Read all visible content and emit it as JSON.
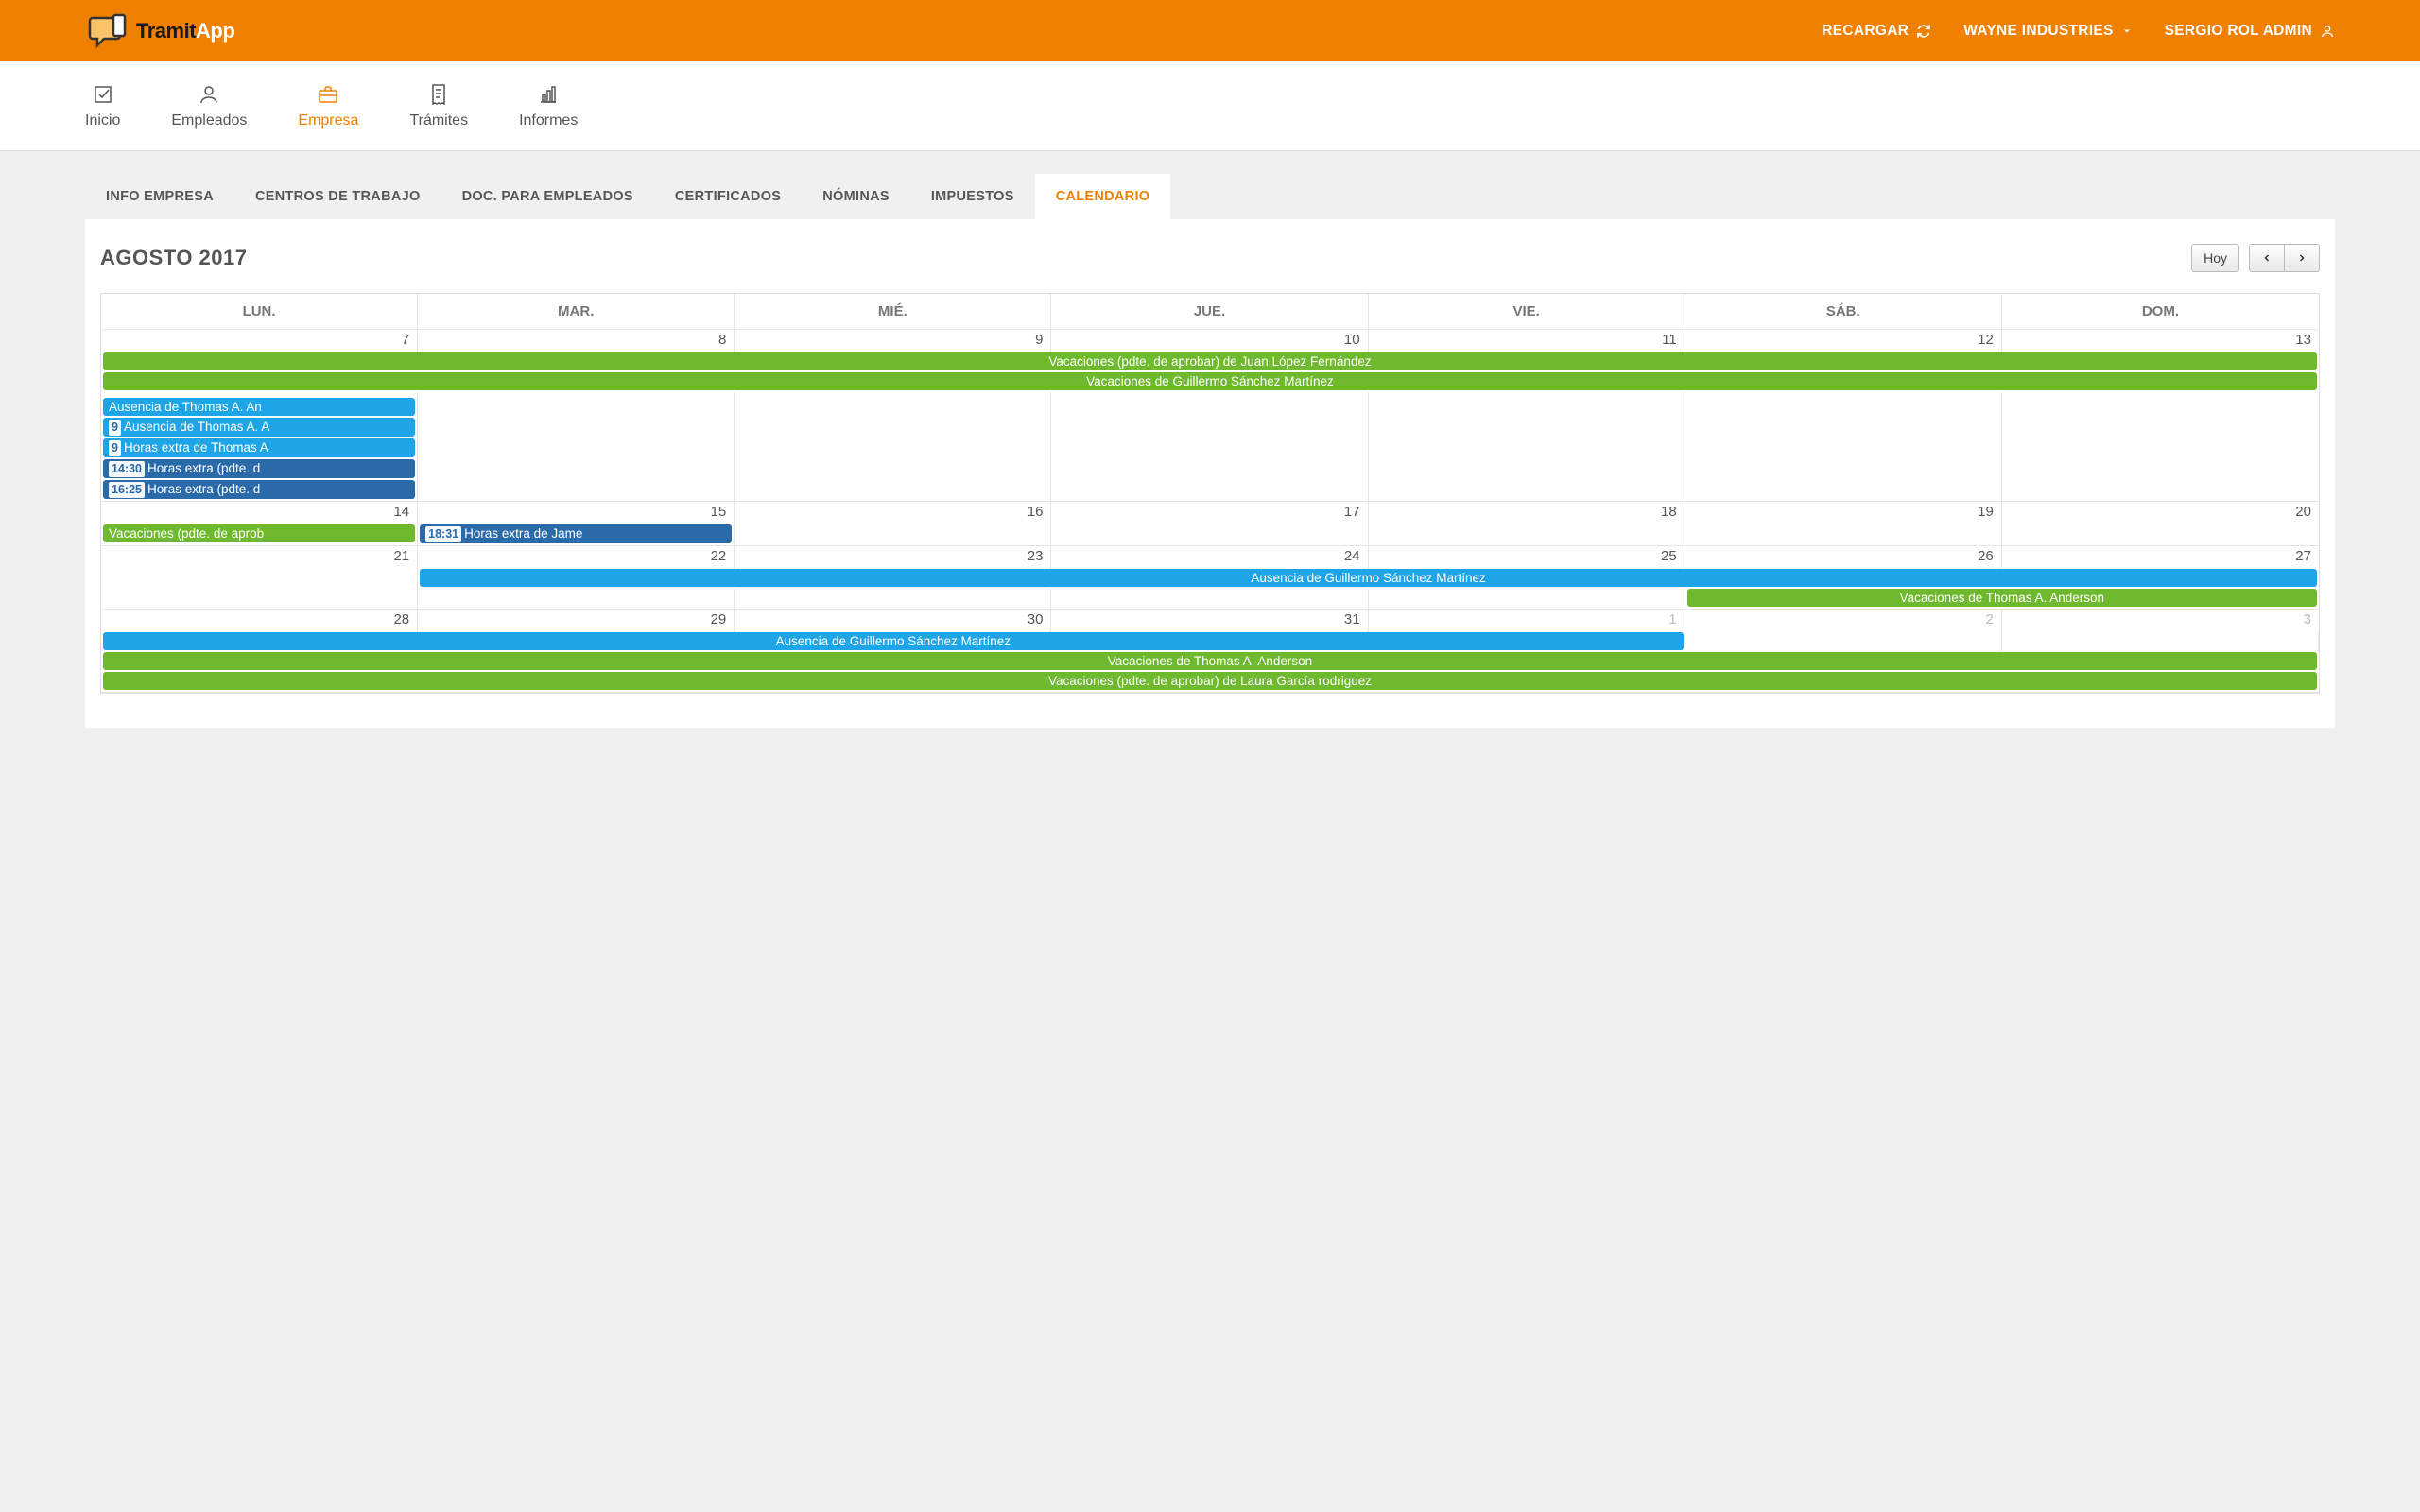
{
  "logo": {
    "brand": "Tramit",
    "suffix": "App"
  },
  "top": {
    "reload": "RECARGAR",
    "company": "WAYNE INDUSTRIES",
    "user": "SERGIO ROL ADMIN"
  },
  "nav": {
    "inicio": "Inicio",
    "empleados": "Empleados",
    "empresa": "Empresa",
    "tramites": "Trámites",
    "informes": "Informes"
  },
  "tabs": {
    "info": "INFO EMPRESA",
    "centros": "CENTROS DE TRABAJO",
    "docs": "DOC. PARA EMPLEADOS",
    "certs": "CERTIFICADOS",
    "nominas": "NÓMINAS",
    "impuestos": "IMPUESTOS",
    "calendario": "CALENDARIO"
  },
  "calendar": {
    "title": "AGOSTO 2017",
    "today": "Hoy",
    "days": {
      "lun": "LUN.",
      "mar": "MAR.",
      "mie": "MIÉ.",
      "jue": "JUE.",
      "vie": "VIE.",
      "sab": "SÁB.",
      "dom": "DOM."
    }
  },
  "weeks": [
    {
      "nums": [
        "7",
        "8",
        "9",
        "10",
        "11",
        "12",
        "13"
      ],
      "other": [],
      "events": [
        {
          "col": 1,
          "span": 7,
          "cls": "green",
          "text": "Vacaciones (pdte. de aprobar) de Juan López Fernández"
        },
        {
          "col": 1,
          "span": 7,
          "cls": "green",
          "text": "Vacaciones de Guillermo Sánchez Martínez"
        }
      ],
      "day1": [
        {
          "cls": "blue-light",
          "text": "Ausencia de Thomas A. An"
        },
        {
          "cls": "blue-light",
          "time": "9",
          "text": "Ausencia de Thomas A. A"
        },
        {
          "cls": "blue-light",
          "time": "9",
          "text": "Horas extra de Thomas A"
        },
        {
          "cls": "blue-dark",
          "time": "14:30",
          "text": "Horas extra (pdte. d"
        },
        {
          "cls": "blue-dark",
          "time": "16:25",
          "text": "Horas extra (pdte. d"
        }
      ]
    },
    {
      "nums": [
        "14",
        "15",
        "16",
        "17",
        "18",
        "19",
        "20"
      ],
      "other": [],
      "events": [],
      "inline": [
        {
          "col": 1,
          "cls": "green",
          "text": "Vacaciones (pdte. de aprob"
        },
        {
          "col": 2,
          "cls": "blue-dark",
          "time": "18:31",
          "text": "Horas extra de Jame"
        }
      ]
    },
    {
      "nums": [
        "21",
        "22",
        "23",
        "24",
        "25",
        "26",
        "27"
      ],
      "other": [],
      "events": [
        {
          "col": 2,
          "span": 6,
          "cls": "blue-light",
          "text": "Ausencia de Guillermo Sánchez Martínez"
        },
        {
          "col": 6,
          "span": 2,
          "cls": "green",
          "text": "Vacaciones de Thomas A. Anderson"
        }
      ]
    },
    {
      "nums": [
        "28",
        "29",
        "30",
        "31",
        "1",
        "2",
        "3"
      ],
      "other": [
        5,
        6,
        7
      ],
      "events": [
        {
          "col": 1,
          "span": 5,
          "cls": "blue-light",
          "text": "Ausencia de Guillermo Sánchez Martínez"
        },
        {
          "col": 1,
          "span": 7,
          "cls": "green",
          "text": "Vacaciones de Thomas A. Anderson"
        },
        {
          "col": 1,
          "span": 7,
          "cls": "green",
          "text": "Vacaciones (pdte. de aprobar) de Laura García rodriguez"
        }
      ]
    }
  ]
}
